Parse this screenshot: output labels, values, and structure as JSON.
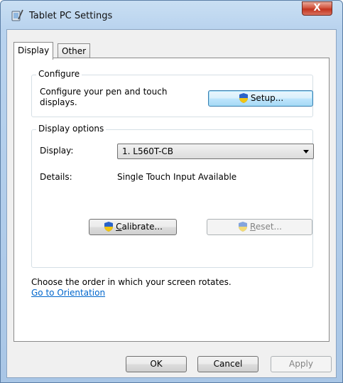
{
  "window": {
    "title": "Tablet PC Settings",
    "close_glyph": "X"
  },
  "tabs": [
    {
      "label": "Display"
    },
    {
      "label": "Other"
    }
  ],
  "configure": {
    "group_title": "Configure",
    "description_line1": "Configure your pen and touch",
    "description_line2": "displays.",
    "setup_button": "Setup..."
  },
  "display_options": {
    "group_title": "Display options",
    "display_label": "Display:",
    "display_value": "1. L560T-CB",
    "details_label": "Details:",
    "details_value": "Single Touch Input Available",
    "calibrate_first": "C",
    "calibrate_rest": "alibrate...",
    "reset_first": "R",
    "reset_rest": "eset..."
  },
  "orientation": {
    "text": "Choose the order in which your screen rotates.",
    "link": "Go to Orientation"
  },
  "footer": {
    "ok": "OK",
    "cancel": "Cancel",
    "apply": "Apply"
  },
  "colors": {
    "link": "#0066cc",
    "close": "#c2341f",
    "shield_blue": "#2a63c9",
    "shield_yellow": "#f2c511"
  }
}
